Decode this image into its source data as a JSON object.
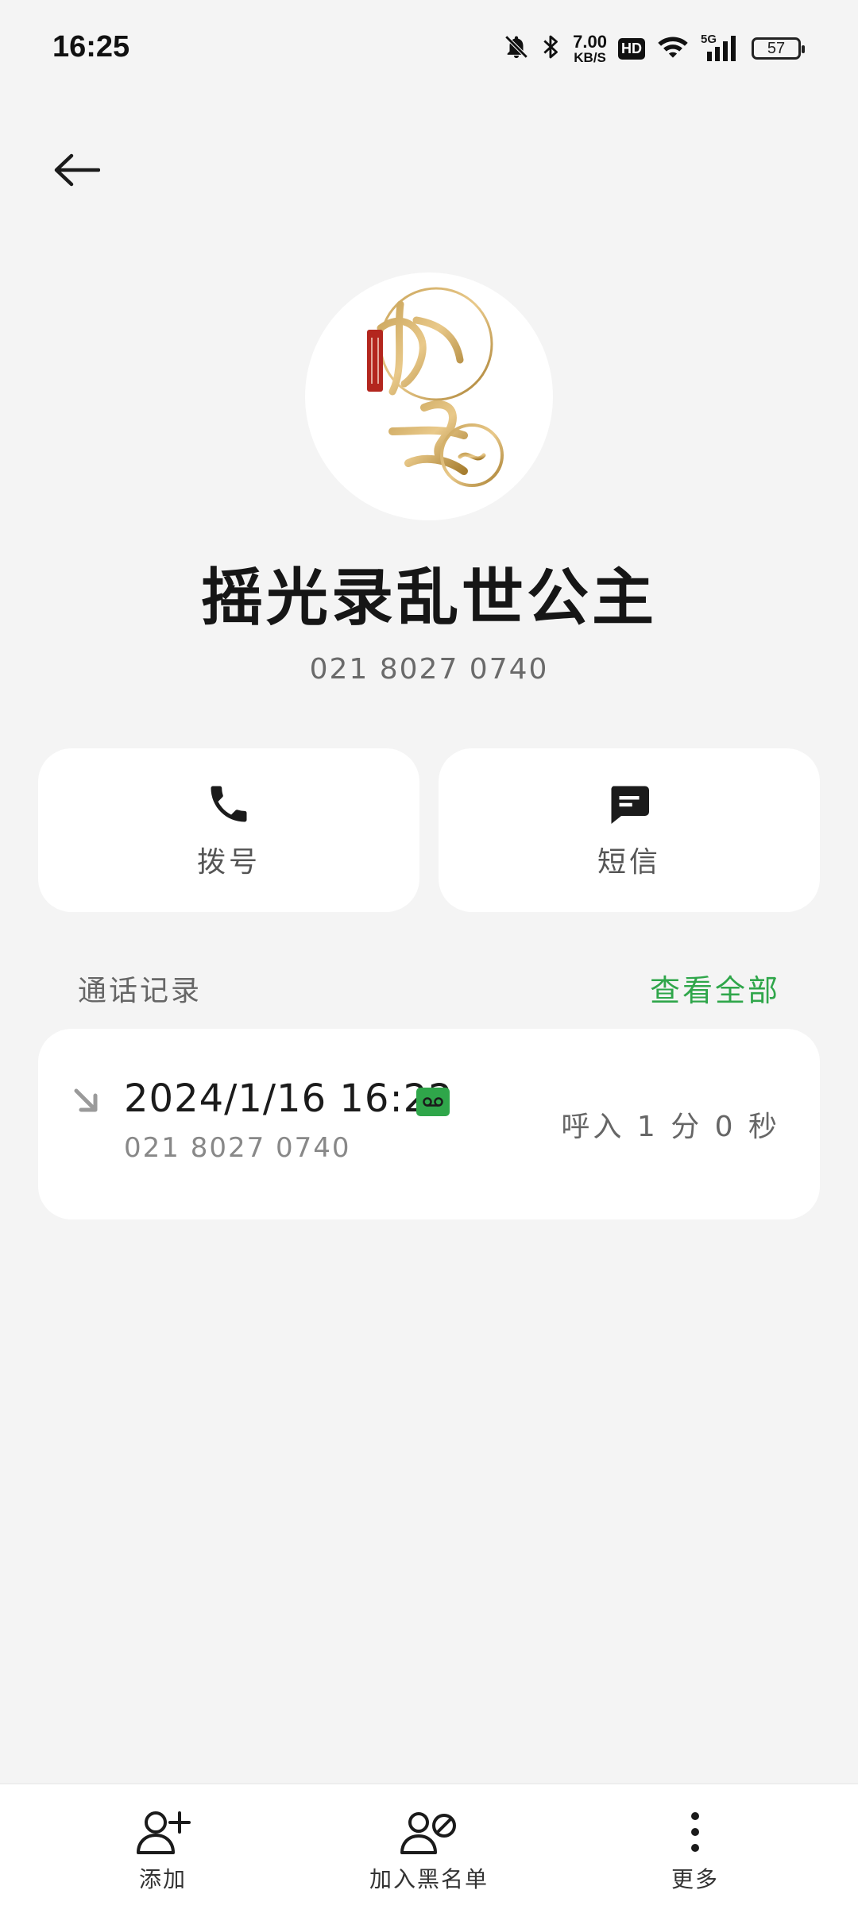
{
  "status_bar": {
    "time": "16:25",
    "net_speed_value": "7.00",
    "net_speed_unit": "KB/S",
    "hd_label": "HD",
    "network_label": "5G",
    "battery_level": "57"
  },
  "contact": {
    "name": "摇光录乱世公主",
    "number": "021 8027 0740"
  },
  "actions": {
    "call_label": "拨号",
    "sms_label": "短信"
  },
  "call_log": {
    "section_title": "通话记录",
    "view_all_label": "查看全部",
    "entries": [
      {
        "datetime": "2024/1/16 16:22",
        "number": "021 8027 0740",
        "detail": "呼入 1 分 0 秒",
        "direction": "incoming"
      }
    ]
  },
  "bottom_bar": {
    "add_label": "添加",
    "block_label": "加入黑名单",
    "more_label": "更多"
  },
  "colors": {
    "accent_green": "#2fa64a",
    "background": "#f4f4f4",
    "card": "#ffffff"
  }
}
